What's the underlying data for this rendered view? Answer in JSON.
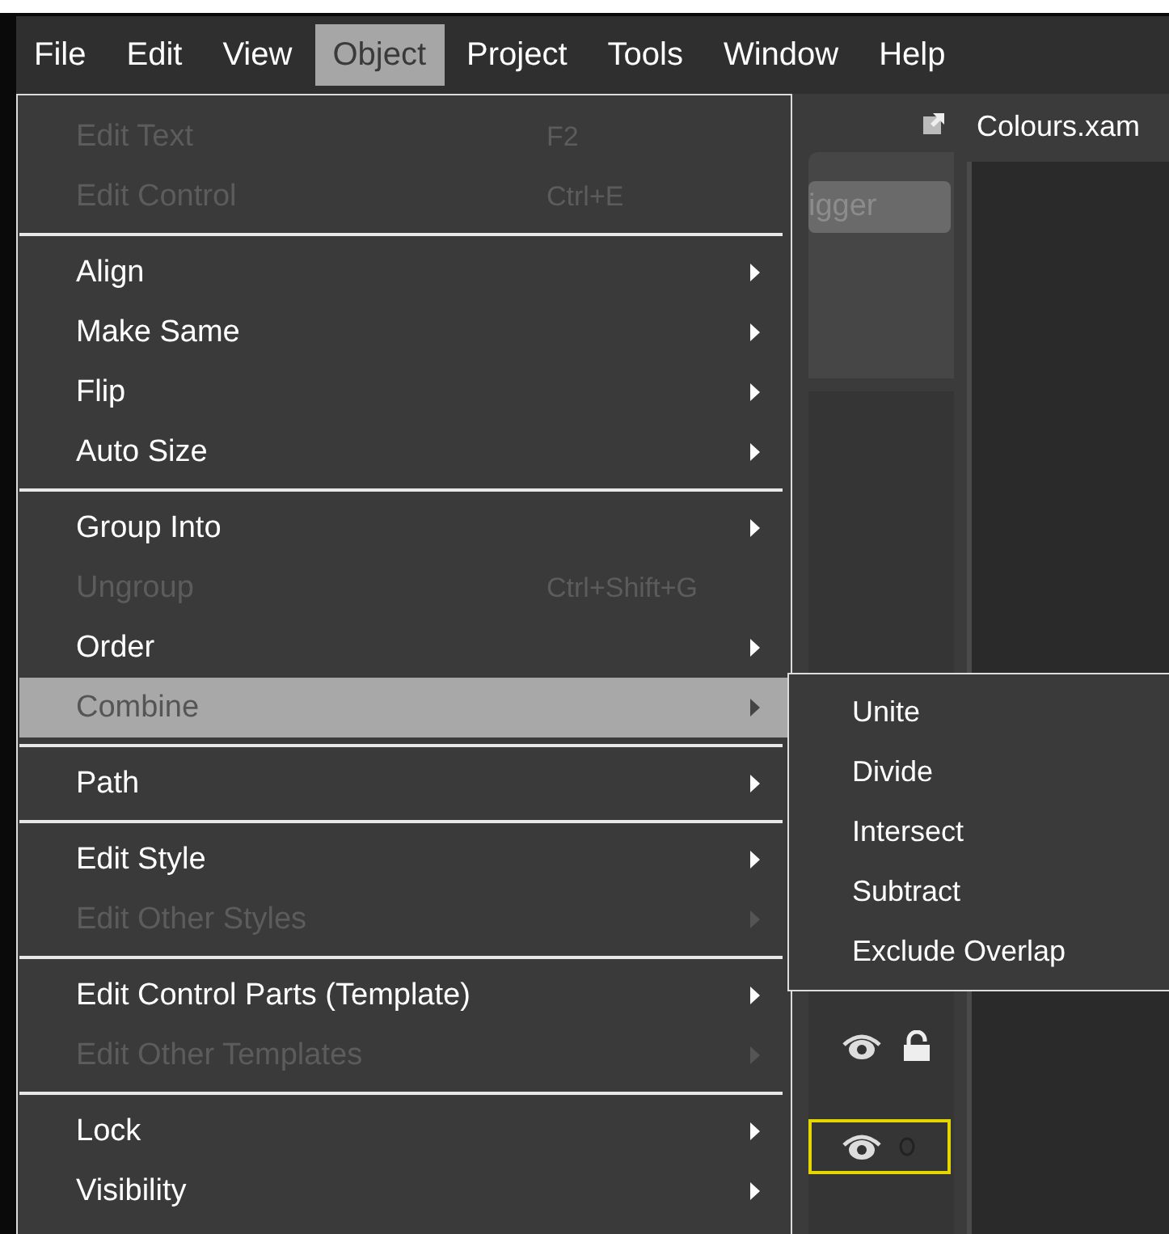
{
  "menubar": [
    {
      "label": "File",
      "selected": false
    },
    {
      "label": "Edit",
      "selected": false
    },
    {
      "label": "View",
      "selected": false
    },
    {
      "label": "Object",
      "selected": true
    },
    {
      "label": "Project",
      "selected": false
    },
    {
      "label": "Tools",
      "selected": false
    },
    {
      "label": "Window",
      "selected": false
    },
    {
      "label": "Help",
      "selected": false
    }
  ],
  "background": {
    "document_tab": "Colours.xam",
    "button_label": "igger"
  },
  "menu": [
    {
      "kind": "item",
      "label": "Edit Text",
      "shortcut": "F2",
      "disabled": true,
      "submenu": false,
      "selected": false
    },
    {
      "kind": "item",
      "label": "Edit Control",
      "shortcut": "Ctrl+E",
      "disabled": true,
      "submenu": false,
      "selected": false
    },
    {
      "kind": "separator"
    },
    {
      "kind": "item",
      "label": "Align",
      "disabled": false,
      "submenu": true,
      "selected": false
    },
    {
      "kind": "item",
      "label": "Make Same",
      "disabled": false,
      "submenu": true,
      "selected": false
    },
    {
      "kind": "item",
      "label": "Flip",
      "disabled": false,
      "submenu": true,
      "selected": false
    },
    {
      "kind": "item",
      "label": "Auto Size",
      "disabled": false,
      "submenu": true,
      "selected": false
    },
    {
      "kind": "separator"
    },
    {
      "kind": "item",
      "label": "Group Into",
      "disabled": false,
      "submenu": true,
      "selected": false
    },
    {
      "kind": "item",
      "label": "Ungroup",
      "shortcut": "Ctrl+Shift+G",
      "disabled": true,
      "submenu": false,
      "selected": false
    },
    {
      "kind": "item",
      "label": "Order",
      "disabled": false,
      "submenu": true,
      "selected": false
    },
    {
      "kind": "item",
      "label": "Combine",
      "disabled": false,
      "submenu": true,
      "selected": true
    },
    {
      "kind": "separator"
    },
    {
      "kind": "item",
      "label": "Path",
      "disabled": false,
      "submenu": true,
      "selected": false
    },
    {
      "kind": "separator"
    },
    {
      "kind": "item",
      "label": "Edit Style",
      "disabled": false,
      "submenu": true,
      "selected": false
    },
    {
      "kind": "item",
      "label": "Edit Other Styles",
      "disabled": true,
      "submenu": true,
      "selected": false
    },
    {
      "kind": "separator"
    },
    {
      "kind": "item",
      "label": "Edit Control Parts (Template)",
      "disabled": false,
      "submenu": true,
      "selected": false
    },
    {
      "kind": "item",
      "label": "Edit Other Templates",
      "disabled": true,
      "submenu": true,
      "selected": false
    },
    {
      "kind": "separator"
    },
    {
      "kind": "item",
      "label": "Lock",
      "disabled": false,
      "submenu": true,
      "selected": false
    },
    {
      "kind": "item",
      "label": "Visibility",
      "disabled": false,
      "submenu": true,
      "selected": false
    }
  ],
  "submenu": [
    {
      "label": "Unite"
    },
    {
      "label": "Divide"
    },
    {
      "label": "Intersect"
    },
    {
      "label": "Subtract"
    },
    {
      "label": "Exclude Overlap"
    }
  ]
}
